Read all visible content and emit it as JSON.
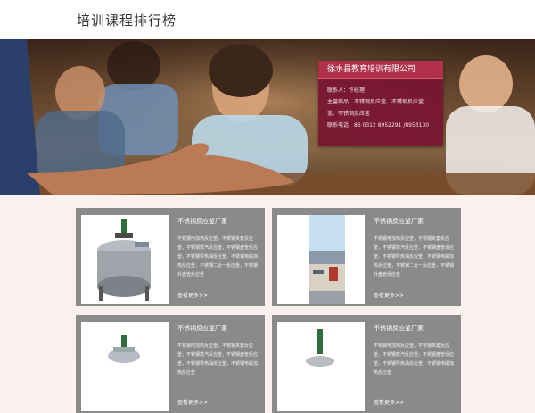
{
  "header": {
    "title": "培训课程排行榜"
  },
  "company": {
    "name": "徐水县教育培训有限公司",
    "contact": "联系人：许经理",
    "products_line1": "主营商品：不锈钢反应釜、不锈钢反应釜",
    "products_line2": "釜、不锈钢反应釜",
    "phone": "联系电话：86 0312 8952291 /8953130"
  },
  "products": [
    {
      "title": "不锈钢反应釜厂家",
      "desc": "不锈钢电加热反应釜，不锈钢夹套反应釜，不锈钢蒸汽反应釜，不锈钢盘管反应釜，不锈钢导热油反应釜，不锈钢电磁加热反应釜，不锈钢二合一反应釜，不锈钢外盘管反应釜",
      "more": "查看更多>>",
      "image": "reactor-kettle"
    },
    {
      "title": "不锈钢反应釜厂家",
      "desc": "不锈钢电加热反应釜，不锈钢夹套反应釜，不锈钢蒸汽反应釜，不锈钢盘管反应釜，不锈钢导热油反应釜，不锈钢电磁加热反应釜，不锈钢二合一反应釜，不锈钢外盘管反应釜",
      "more": "查看更多>>",
      "image": "factory-building"
    },
    {
      "title": "不锈钢反应釜厂家",
      "desc": "不锈钢电加热反应釜，不锈钢夹套反应釜，不锈钢蒸汽反应釜，不锈钢盘管反应釜，不锈钢导热油反应釜，不锈钢电磁加热反应釜",
      "more": "查看更多>>",
      "image": "reactor-kettle"
    },
    {
      "title": "不锈钢反应釜厂家",
      "desc": "不锈钢电加热反应釜，不锈钢夹套反应釜，不锈钢蒸汽反应釜，不锈钢盘管反应釜，不锈钢导热油反应釜，不锈钢电磁加热反应釜",
      "more": "查看更多>>",
      "image": "reactor-kettle"
    }
  ],
  "colors": {
    "card_header": "#b0304a",
    "card_body": "#78142f",
    "product_tile": "#8a8a8a",
    "page_background": "#fbf1ee"
  }
}
